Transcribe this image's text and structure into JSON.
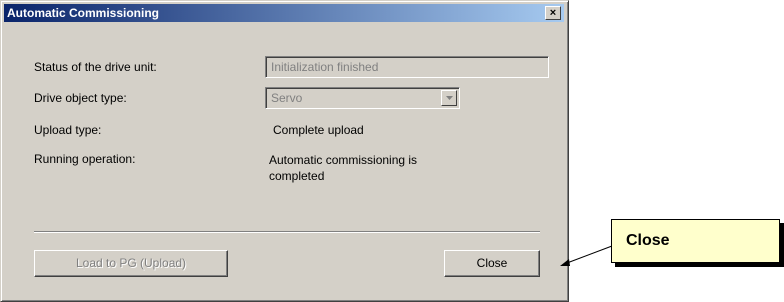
{
  "window": {
    "title": "Automatic Commissioning",
    "close_glyph": "×"
  },
  "fields": {
    "status_label": "Status of the drive unit:",
    "status_value": "Initialization finished",
    "drive_object_label": "Drive object type:",
    "drive_object_value": "Servo",
    "upload_type_label": "Upload type:",
    "upload_type_value": "Complete upload",
    "running_operation_label": "Running operation:",
    "running_operation_value": "Automatic commissioning is completed"
  },
  "buttons": {
    "load_label": "Load to PG (Upload)",
    "close_label": "Close"
  },
  "callout": {
    "text": "Close"
  },
  "icons": {
    "title_close": "close-icon",
    "combo_arrow": "chevron-down-icon",
    "callout_arrow": "arrow-pointer"
  },
  "colors": {
    "dialog_bg": "#d4d0c8",
    "title_start": "#0a246a",
    "title_end": "#a6caf0",
    "callout_bg": "#ffffcc"
  }
}
